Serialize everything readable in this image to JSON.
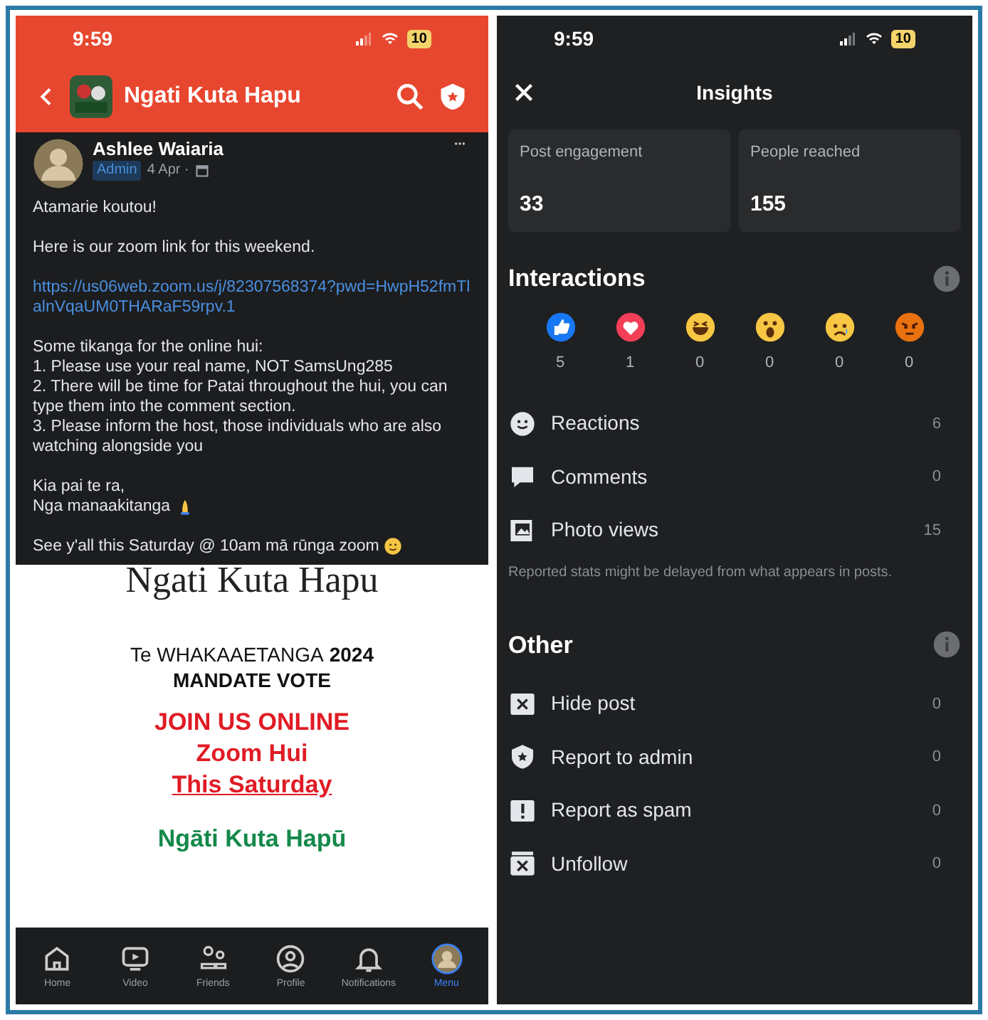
{
  "left_phone": {
    "status_bar": {
      "time": "9:59",
      "battery": "10"
    },
    "header": {
      "title": "Ngati Kuta Hapu"
    },
    "post": {
      "author": "Ashlee Waiaria",
      "badge": "Admin",
      "date": "4 Apr ·",
      "paragraphs": [
        {
          "kind": "text",
          "lines": [
            "Atamarie koutou!"
          ]
        },
        {
          "kind": "text",
          "lines": [
            "Here is our zoom link for this weekend."
          ]
        },
        {
          "kind": "link",
          "lines": [
            "https://us06web.zoom.us/j/82307568374?pwd=HwpH52fmTlalnVqaUM0THARaF59rpv.1"
          ]
        },
        {
          "kind": "text",
          "lines": [
            "Some tikanga for the online hui:",
            "1. Please use your real name, NOT SamsUng285",
            "2. There will be time for Patai throughout the hui, you can type them into the comment section.",
            "3. Please inform the host, those individuals who are also watching alongside you"
          ]
        },
        {
          "kind": "text",
          "lines": [
            "Kia pai te ra,",
            {
              "kind": "pray",
              "text": "Nga manaakitanga"
            }
          ]
        },
        {
          "kind": "text",
          "lines": [
            {
              "kind": "smile",
              "text": "See y'all this Saturday @ 10am mā rūnga zoom"
            }
          ]
        }
      ]
    },
    "poster": {
      "heading": "Ngati Kuta Hapu",
      "lines": [
        {
          "kind": "dark",
          "parts": [
            "Te WHAKAAETANGA",
            "2024"
          ]
        },
        {
          "kind": "dark",
          "parts": [
            "MANDATE VOTE"
          ]
        },
        {
          "kind": "red",
          "parts": [
            "JOIN US ONLINE"
          ]
        },
        {
          "kind": "red",
          "parts": [
            "Zoom Hui"
          ]
        },
        {
          "kind": "red_underline",
          "parts": [
            "This Saturday"
          ]
        },
        {
          "kind": "green",
          "parts": [
            "Ngāti Kuta Hapū"
          ]
        }
      ]
    },
    "nav": [
      {
        "kind": "home",
        "label": "Home",
        "selected": false
      },
      {
        "kind": "video",
        "label": "Video",
        "selected": false
      },
      {
        "kind": "friends",
        "label": "Friends",
        "selected": false
      },
      {
        "kind": "profile",
        "label": "Profile",
        "selected": false
      },
      {
        "kind": "bell",
        "label": "Notifications",
        "selected": false
      },
      {
        "kind": "avatar",
        "label": "Menu",
        "selected": true
      }
    ]
  },
  "right_phone": {
    "status_bar": {
      "time": "9:59",
      "battery": "10"
    },
    "title": "Insights",
    "cards": [
      {
        "label": "Post engagement",
        "value": "33"
      },
      {
        "label": "People reached",
        "value": "155"
      }
    ],
    "interactions": {
      "heading": "Interactions",
      "reactions": [
        {
          "kind": "like",
          "count": "5"
        },
        {
          "kind": "love",
          "count": "1"
        },
        {
          "kind": "haha",
          "count": "0"
        },
        {
          "kind": "wow",
          "count": "0"
        },
        {
          "kind": "sad",
          "count": "0"
        },
        {
          "kind": "angry",
          "count": "0"
        }
      ],
      "rows": [
        {
          "kind": "smile",
          "label": "Reactions",
          "value": "6"
        },
        {
          "kind": "comment",
          "label": "Comments",
          "value": "0"
        },
        {
          "kind": "photo",
          "label": "Photo views",
          "value": "15"
        }
      ],
      "note": "Reported stats might be delayed from what appears in posts."
    },
    "other": {
      "heading": "Other",
      "rows": [
        {
          "kind": "hide",
          "label": "Hide post",
          "value": "0"
        },
        {
          "kind": "shield",
          "label": "Report to admin",
          "value": "0"
        },
        {
          "kind": "spam",
          "label": "Report as spam",
          "value": "0"
        },
        {
          "kind": "unfollow",
          "label": "Unfollow",
          "value": "0"
        }
      ]
    }
  }
}
